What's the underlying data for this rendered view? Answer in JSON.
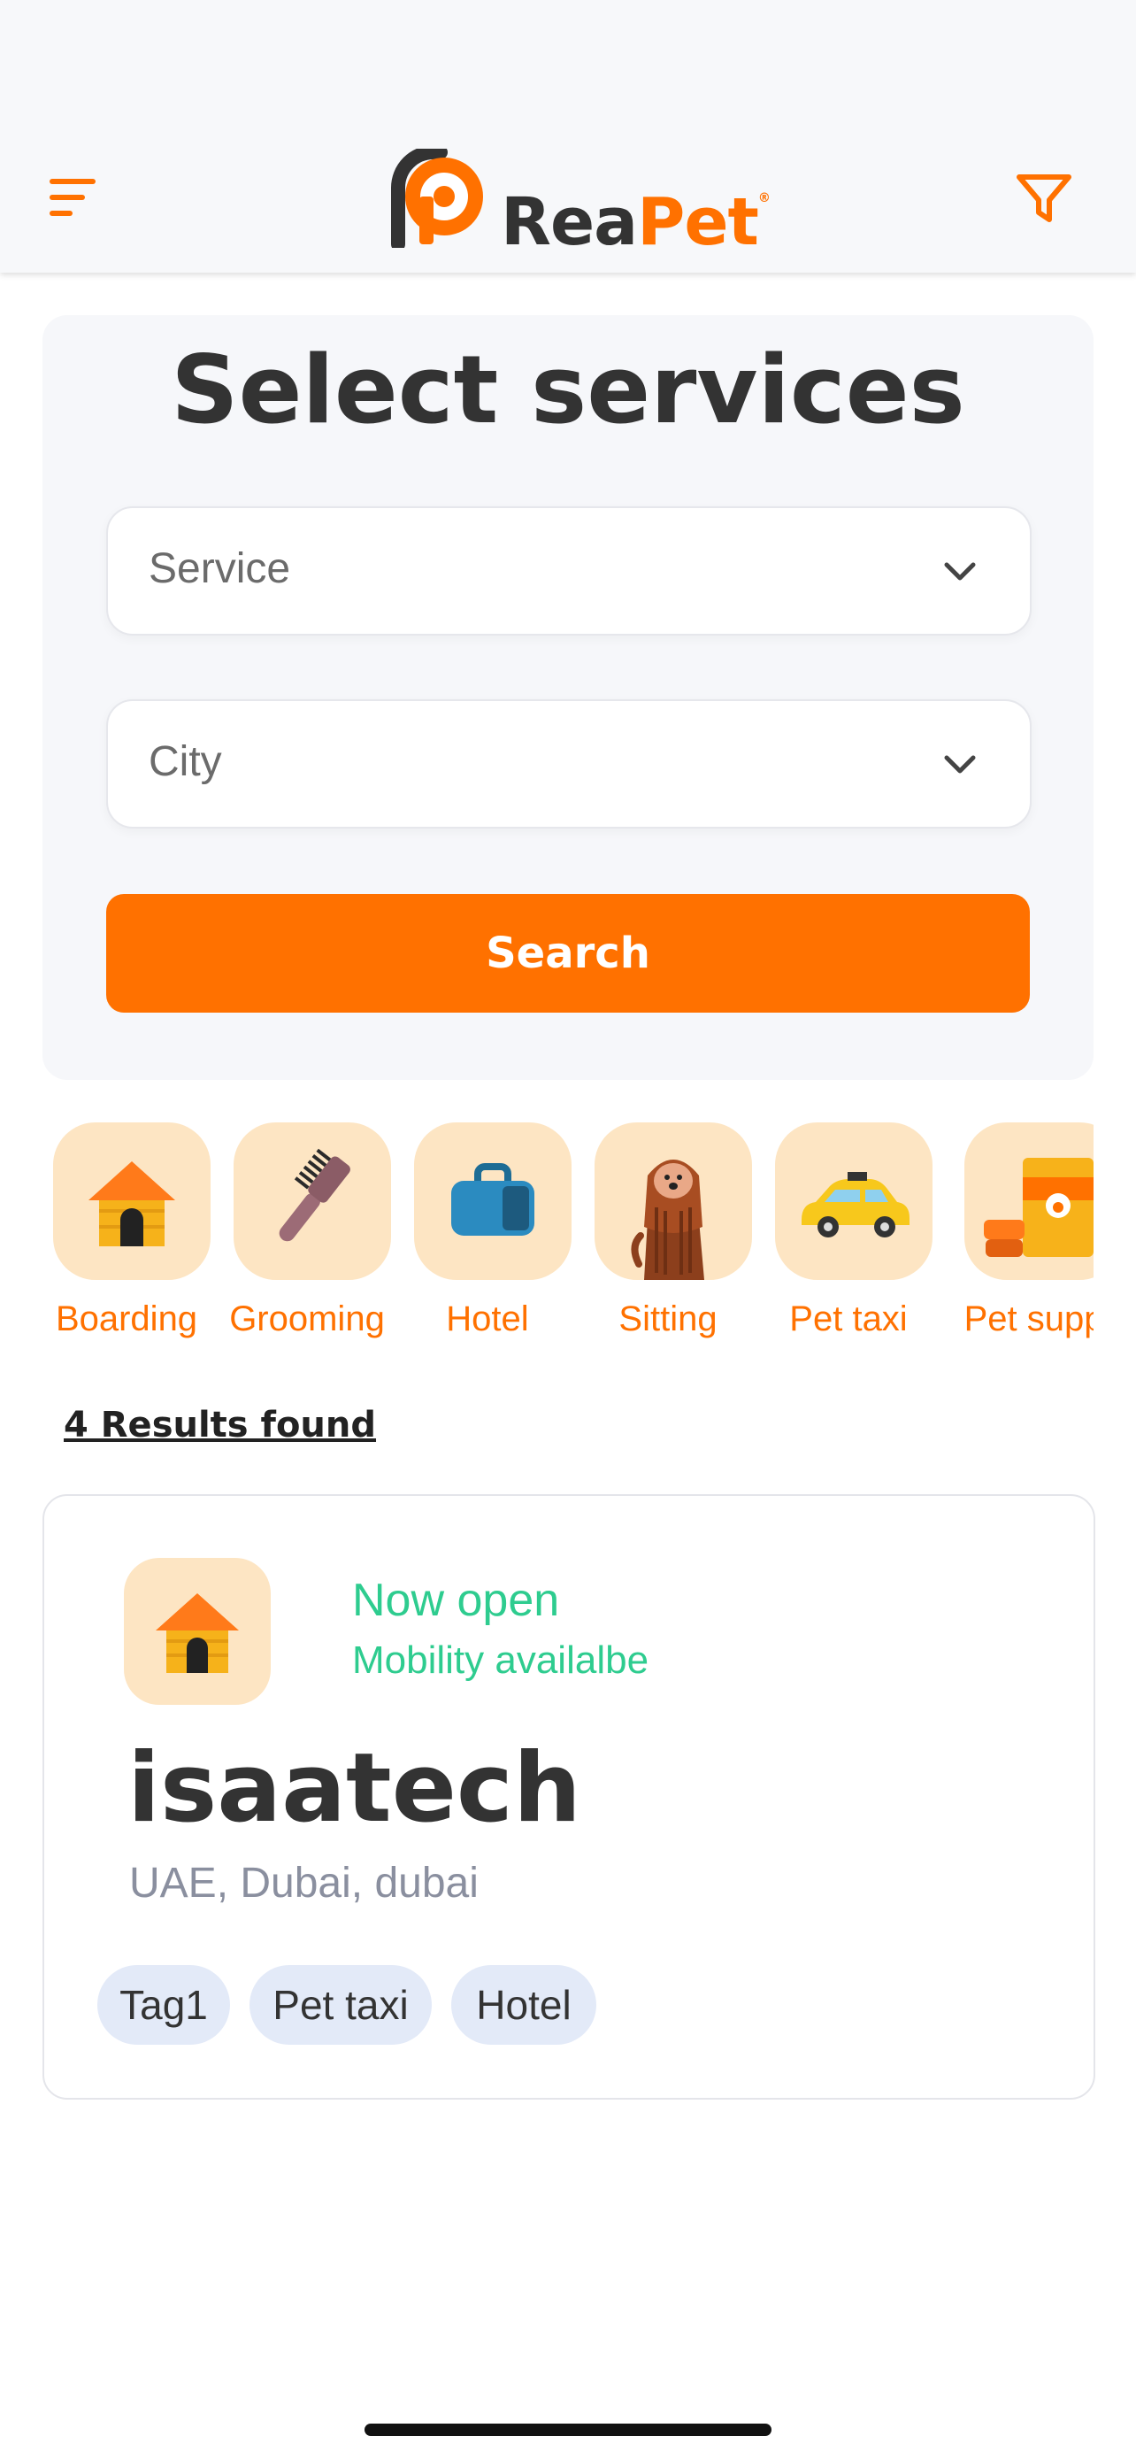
{
  "header": {
    "logo_part1": "Rea",
    "logo_part2": "Pet",
    "logo_mark": "®",
    "menu_icon": "menu-lines-icon",
    "filter_icon": "funnel-filter-icon"
  },
  "search_panel": {
    "title": "Select services",
    "service_placeholder": "Service",
    "city_placeholder": "City",
    "search_label": "Search"
  },
  "categories": [
    {
      "label": "Boarding",
      "icon": "dog-house-icon"
    },
    {
      "label": "Grooming",
      "icon": "grooming-brush-icon"
    },
    {
      "label": "Hotel",
      "icon": "pet-carrier-icon"
    },
    {
      "label": "Sitting",
      "icon": "sitting-dog-icon"
    },
    {
      "label": "Pet taxi",
      "icon": "taxi-car-icon"
    },
    {
      "label": "Pet suppl",
      "icon": "pet-food-icon"
    }
  ],
  "results": {
    "count_text": "4 Results found"
  },
  "listing": {
    "status": "Now open",
    "mobility": "Mobility availalbe",
    "name": "isaatech",
    "location": "UAE, Dubai, dubai",
    "tags": [
      "Tag1",
      "Pet taxi",
      "Hotel"
    ],
    "icon": "dog-house-icon"
  },
  "colors": {
    "accent": "#ff7100",
    "open_green": "#2ecc8f",
    "tile_bg": "#fde5c3",
    "tag_bg": "#e3eaf8"
  }
}
